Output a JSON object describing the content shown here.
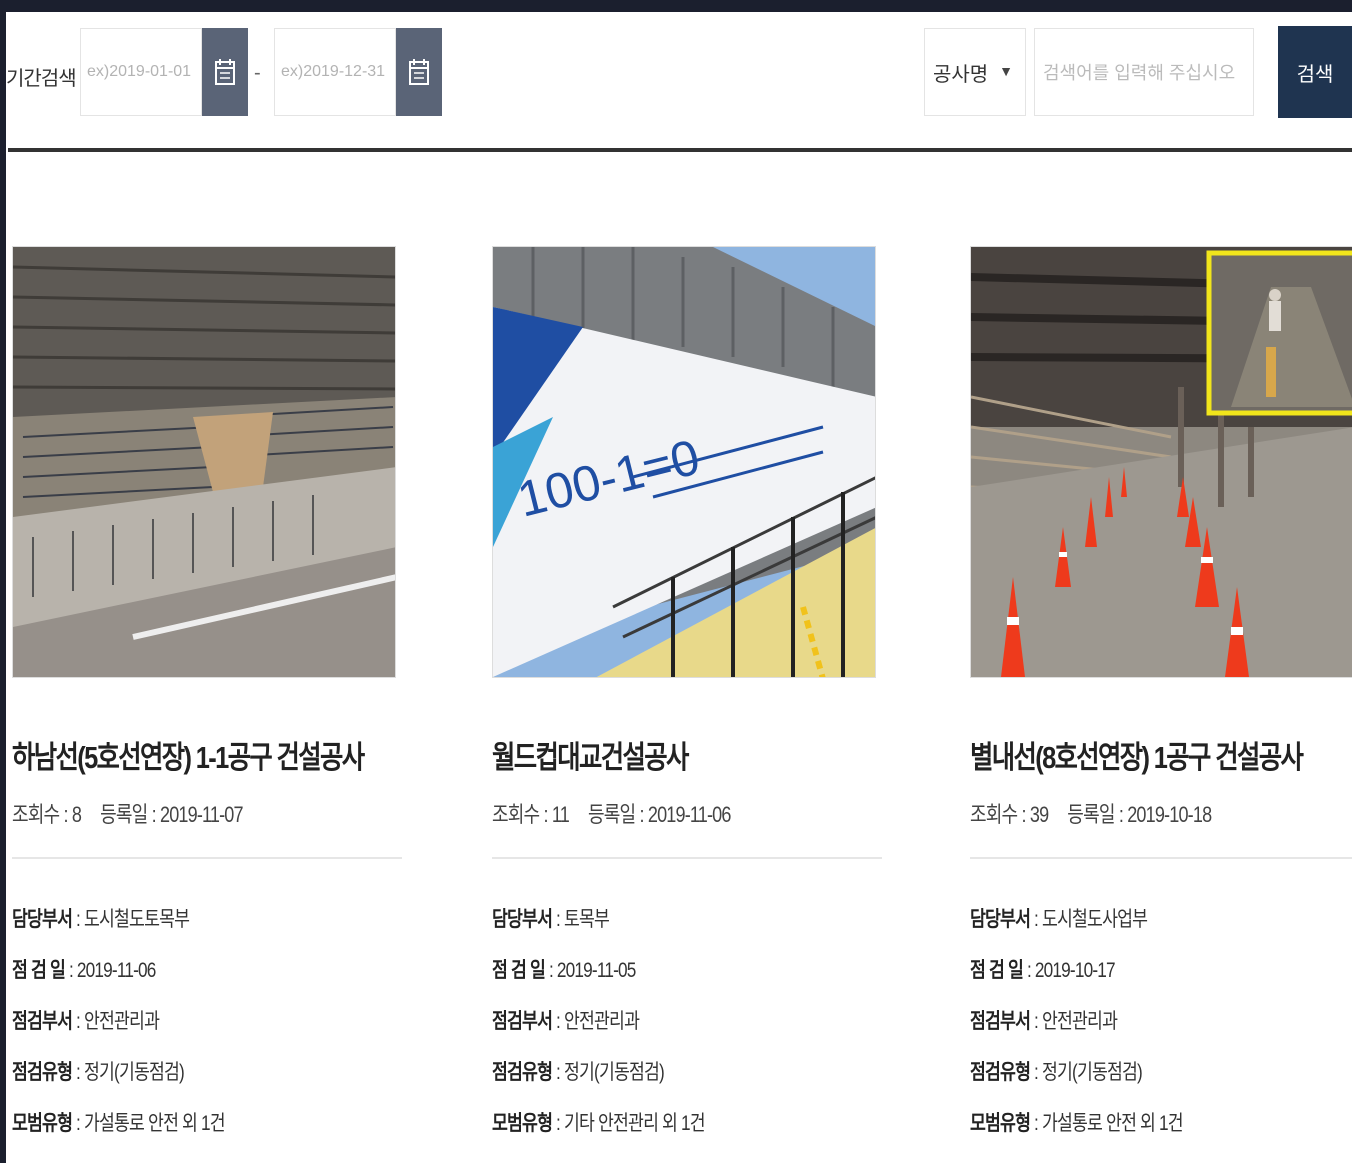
{
  "search": {
    "period_label": "기간검색",
    "start_placeholder": "ex)2019-01-01",
    "end_placeholder": "ex)2019-12-31",
    "range_separator": "-",
    "field_select_value": "공사명",
    "keyword_placeholder": "검색어를 입력해 주십시오",
    "search_button_label": "검색"
  },
  "cards": [
    {
      "title": "하남선(5호선연장) 1-1공구 건설공사",
      "views": "조회수 : 8",
      "registered": "등록일 : 2019-11-07",
      "department_label": "담당부서",
      "department": "도시철도토목부",
      "inspection_date_label": "점 검 일",
      "inspection_date": "2019-11-06",
      "inspection_dept_label": "점검부서",
      "inspection_dept": "안전관리과",
      "inspection_type_label": "점검유형",
      "inspection_type": "정기(기동점검)",
      "example_type_label": "모범유형",
      "example_type": "가설통로 안전 외 1건"
    },
    {
      "title": "월드컵대교건설공사",
      "views": "조회수 : 11",
      "registered": "등록일 : 2019-11-06",
      "department_label": "담당부서",
      "department": "토목부",
      "inspection_date_label": "점 검 일",
      "inspection_date": "2019-11-05",
      "inspection_dept_label": "점검부서",
      "inspection_dept": "안전관리과",
      "inspection_type_label": "점검유형",
      "inspection_type": "정기(기동점검)",
      "example_type_label": "모범유형",
      "example_type": "기타 안전관리 외 1건",
      "banner_text": "100-1=0"
    },
    {
      "title": "별내선(8호선연장) 1공구 건설공사",
      "views": "조회수 : 39",
      "registered": "등록일 : 2019-10-18",
      "department_label": "담당부서",
      "department": "도시철도사업부",
      "inspection_date_label": "점 검 일",
      "inspection_date": "2019-10-17",
      "inspection_dept_label": "점검부서",
      "inspection_dept": "안전관리과",
      "inspection_type_label": "점검유형",
      "inspection_type": "정기(기동점검)",
      "example_type_label": "모범유형",
      "example_type": "가설통로 안전 외 1건"
    }
  ],
  "colors": {
    "frame": "#1b1f2e",
    "calendar_button": "#5a6477",
    "search_button": "#1f3450",
    "banner_blue": "#1f4ea3",
    "cone_orange": "#ee3a1c",
    "highlight_yellow": "#f1e51b"
  },
  "icons": {
    "calendar": "calendar-icon",
    "dropdown": "chevron-down-icon"
  }
}
